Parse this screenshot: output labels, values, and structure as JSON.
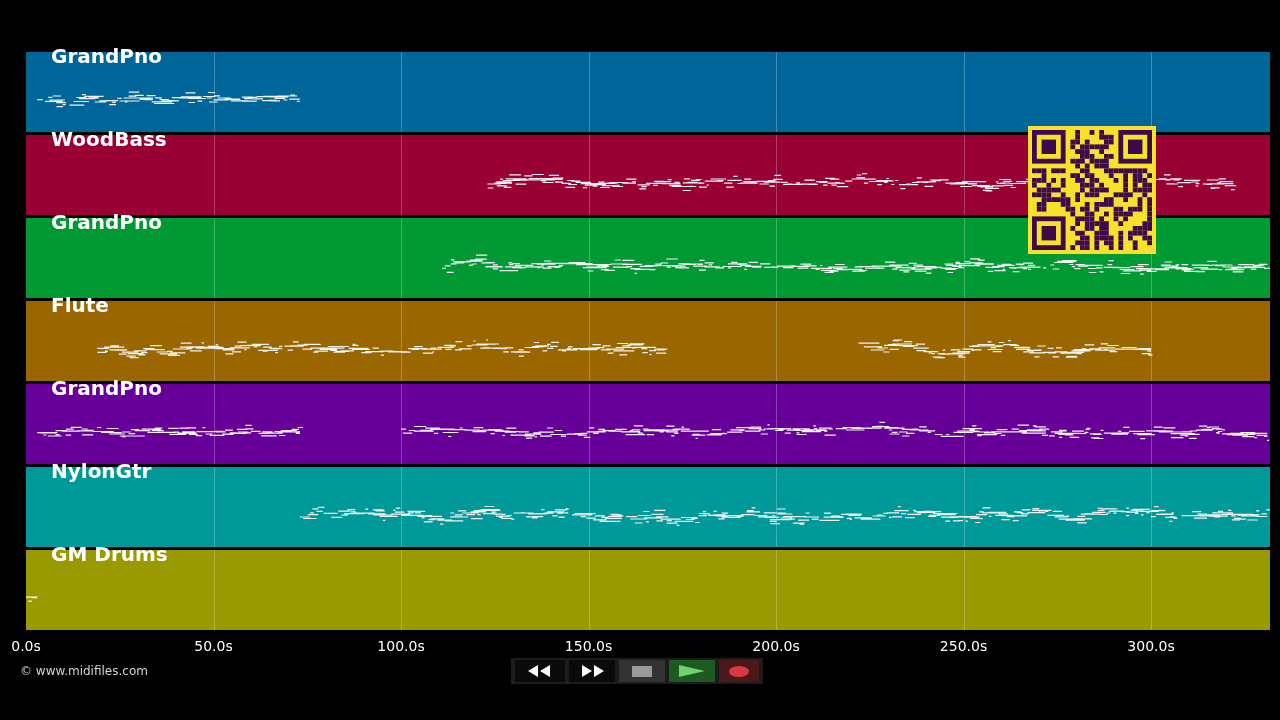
{
  "tracks": [
    {
      "name": "GrandPno",
      "color": "#006699"
    },
    {
      "name": "WoodBass",
      "color": "#990033"
    },
    {
      "name": "GrandPno",
      "color": "#009933"
    },
    {
      "name": "Flute",
      "color": "#996600"
    },
    {
      "name": "GrandPno",
      "color": "#660099"
    },
    {
      "name": "NylonGtr",
      "color": "#009999"
    },
    {
      "name": "GM Drums",
      "color": "#999900"
    }
  ],
  "time_axis": [
    "0.0s",
    "50.0s",
    "100.0s",
    "150.0s",
    "200.0s",
    "250.0s",
    "300.0s"
  ],
  "credit": "© www.midifiles.com"
}
